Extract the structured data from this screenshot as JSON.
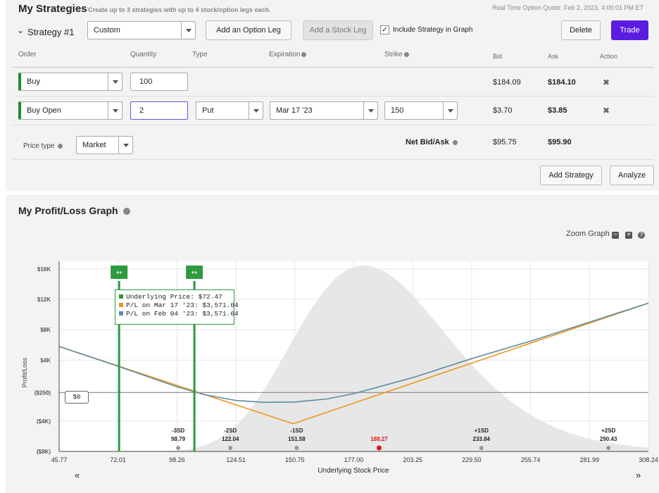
{
  "header": {
    "title": "My Strategies",
    "subtitle": "Create up to 3 strategies with up to 4 stock/option legs each.",
    "quote": "Real Time Option Quote: Feb 2, 2023, 4:00:01 PM ET"
  },
  "strategy": {
    "label": "Strategy #1",
    "type_value": "Custom",
    "add_option_label": "Add an Option Leg",
    "add_stock_label": "Add a Stock Leg",
    "include_label": "Include Strategy in Graph",
    "include_checked": true,
    "delete_label": "Delete",
    "trade_label": "Trade"
  },
  "columns": {
    "order": "Order",
    "quantity": "Quantity",
    "type": "Type",
    "expiration": "Expiration",
    "strike": "Strike",
    "bid": "Bid",
    "ask": "Ask",
    "action": "Action"
  },
  "legs": [
    {
      "order": "Buy",
      "quantity": "100",
      "bid": "$184.09",
      "ask": "$184.10",
      "remove": "✖"
    },
    {
      "order": "Buy Open",
      "quantity": "2",
      "type": "Put",
      "expiration": "Mar 17 '23",
      "strike": "150",
      "bid": "$3.70",
      "ask": "$3.85",
      "remove": "✖"
    }
  ],
  "price_type": {
    "label": "Price type",
    "value": "Market"
  },
  "net": {
    "label": "Net Bid/Ask",
    "bid": "$95.75",
    "ask": "$95.90"
  },
  "bottom_buttons": {
    "add_strategy": "Add Strategy",
    "analyze": "Analyze"
  },
  "graph": {
    "title": "My Profit/Loss Graph",
    "zoom_label": "Zoom Graph",
    "ylabel": "Profit/Loss",
    "xlabel": "Underlying Stock Price",
    "zero_label": "$0",
    "tooltip": {
      "underlying": "Underlying Price: $72.47",
      "pl_exp": "P/L on Mar 17 '23: $3,571.64",
      "pl_now": "P/L on Feb 04 '23: $3,571.64"
    },
    "nav_prev": "«",
    "nav_next": "»",
    "colors": {
      "expiration": "#f0961e",
      "today": "#5b8ca3",
      "handle": "#2e9a40",
      "distribution": "#e7e7e7",
      "current": "#e0141e"
    }
  },
  "chart_data": {
    "type": "line",
    "xlabel": "Underlying Stock Price",
    "ylabel": "Profit/Loss",
    "x_ticks": [
      "45.77",
      "72.01",
      "98.26",
      "124.51",
      "150.75",
      "177.00",
      "203.25",
      "229.50",
      "255.74",
      "281.99",
      "308.24"
    ],
    "y_ticks": [
      {
        "label": "$16K",
        "value": 16000
      },
      {
        "label": "$12K",
        "value": 12000
      },
      {
        "label": "$8K",
        "value": 8000
      },
      {
        "label": "$4K",
        "value": 4000
      },
      {
        "label": "($250)",
        "value": -250
      },
      {
        "label": "($4K)",
        "value": -4000
      },
      {
        "label": "($8K)",
        "value": -8000
      }
    ],
    "xlim": [
      45.77,
      308.24
    ],
    "ylim": [
      -8000,
      17000
    ],
    "series": [
      {
        "name": "P/L on Mar 17 '23",
        "x": [
          45.77,
          150,
          308.24
        ],
        "y": [
          5800,
          -4350,
          11500
        ]
      },
      {
        "name": "P/L on Feb 04 '23",
        "x": [
          45.77,
          72.01,
          98.26,
          110,
          124.51,
          137,
          150.75,
          165,
          177,
          203.25,
          229.5,
          255.74,
          308.24
        ],
        "y": [
          5800,
          3200,
          500,
          -500,
          -1300,
          -1550,
          -1500,
          -1100,
          -400,
          1700,
          4200,
          6500,
          11500
        ]
      }
    ],
    "handles": [
      72.47,
      106
    ],
    "sd_markers": [
      {
        "label": "-3SD",
        "value": "98.79"
      },
      {
        "label": "-2SD",
        "value": "122.04"
      },
      {
        "label": "-1SD",
        "value": "151.58"
      },
      {
        "label": "",
        "value": "188.27",
        "current": true
      },
      {
        "label": "+1SD",
        "value": "233.84"
      },
      {
        "label": "+2SD",
        "value": "290.43"
      }
    ]
  }
}
